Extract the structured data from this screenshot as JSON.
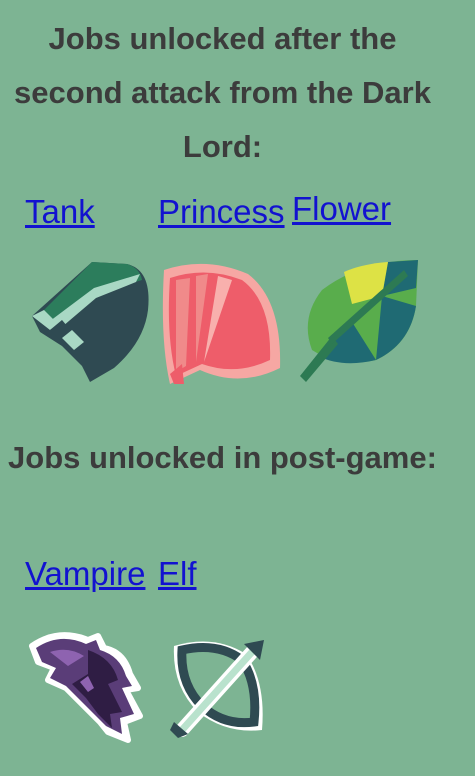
{
  "section1": {
    "heading": "Jobs unlocked after the second attack from the Dark Lord:",
    "jobs": [
      {
        "label": "Tank",
        "icon": "tank-icon"
      },
      {
        "label": "Princess",
        "icon": "princess-fan-icon"
      },
      {
        "label": "Flower",
        "icon": "flower-leaf-icon"
      }
    ]
  },
  "section2": {
    "heading": "Jobs unlocked in post-game:",
    "jobs": [
      {
        "label": "Vampire",
        "icon": "vampire-bat-icon"
      },
      {
        "label": "Elf",
        "icon": "elf-bow-icon"
      }
    ]
  },
  "colors": {
    "background": "#7db493",
    "heading_text": "#3c3c3c",
    "link": "#1212d0"
  }
}
